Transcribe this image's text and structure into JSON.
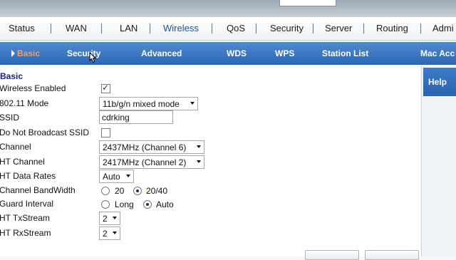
{
  "nav": [
    "Status",
    "WAN",
    "LAN",
    "Wireless",
    "QoS",
    "Security",
    "Server",
    "Routing",
    "Admi"
  ],
  "subnav": [
    "Basic",
    "Security",
    "Advanced",
    "WDS",
    "WPS",
    "Station List",
    "Mac Acc"
  ],
  "help": {
    "title": "Help"
  },
  "form": {
    "section_title": "Basic",
    "wireless_enabled": {
      "label": "Wireless Enabled",
      "checked": true
    },
    "mode": {
      "label": "802.11 Mode",
      "value": "11b/g/n mixed mode"
    },
    "ssid": {
      "label": "SSID",
      "value": "cdrking"
    },
    "no_broadcast": {
      "label": "Do Not Broadcast SSID",
      "checked": false
    },
    "channel": {
      "label": "Channel",
      "value": "2437MHz (Channel 6)"
    },
    "ht_channel": {
      "label": "HT Channel",
      "value": "2417MHz (Channel 2)"
    },
    "ht_data_rates": {
      "label": "HT Data Rates",
      "value": "Auto"
    },
    "bandwidth": {
      "label": "Channel BandWidth",
      "options": [
        "20",
        "20/40"
      ],
      "selected": "20/40"
    },
    "guard": {
      "label": "Guard Interval",
      "options": [
        "Long",
        "Auto"
      ],
      "selected": "Auto"
    },
    "tx_stream": {
      "label": "HT TxStream",
      "value": "2"
    },
    "rx_stream": {
      "label": "HT RxStream",
      "value": "2"
    }
  }
}
